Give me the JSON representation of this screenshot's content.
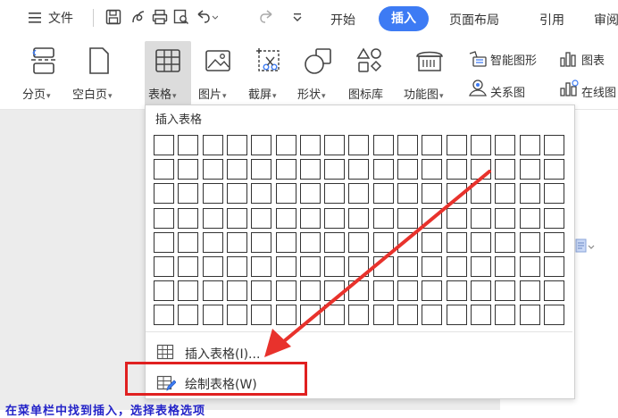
{
  "menu": {
    "file_label": "文件",
    "tabs": [
      {
        "label": "开始"
      },
      {
        "label": "插入"
      },
      {
        "label": "页面布局"
      },
      {
        "label": "引用"
      },
      {
        "label": "审阅"
      }
    ]
  },
  "ribbon": {
    "section_break": "分页",
    "blank_page": "空白页",
    "table": "表格",
    "picture": "图片",
    "screenshot": "截屏",
    "shape": "形状",
    "icon_library": "图标库",
    "function_chart": "功能图",
    "smart_art": "智能图形",
    "chart": "图表",
    "relation_chart": "关系图",
    "online_chart": "在线图"
  },
  "dropdown": {
    "title": "插入表格",
    "grid_rows": 8,
    "grid_cols": 17,
    "insert_table": "插入表格(I)...",
    "draw_table": "绘制表格(W)"
  },
  "caption": "在菜单栏中找到插入，选择表格选项"
}
